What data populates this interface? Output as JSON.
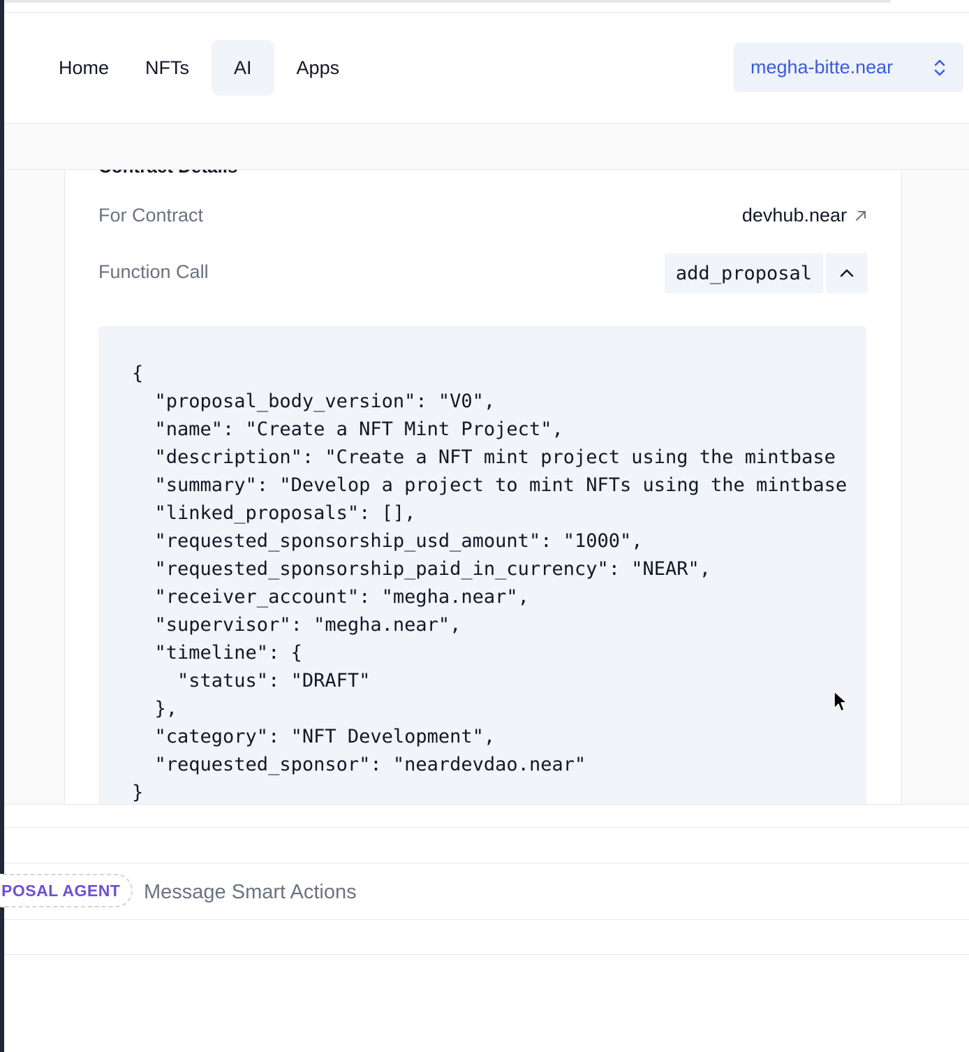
{
  "nav": {
    "items": [
      {
        "label": "Home"
      },
      {
        "label": "NFTs"
      },
      {
        "label": "AI"
      },
      {
        "label": "Apps"
      }
    ],
    "active": "AI"
  },
  "account": {
    "name": "megha-bitte.near",
    "icon": "chevron-up-down-icon"
  },
  "card": {
    "title": "Contract Details",
    "contract_label": "For Contract",
    "contract_value": "devhub.near",
    "function_label": "Function Call",
    "function_value": "add_proposal",
    "code": "{\n  \"proposal_body_version\": \"V0\",\n  \"name\": \"Create a NFT Mint Project\",\n  \"description\": \"Create a NFT mint project using the mintbase\n  \"summary\": \"Develop a project to mint NFTs using the mintbase\n  \"linked_proposals\": [],\n  \"requested_sponsorship_usd_amount\": \"1000\",\n  \"requested_sponsorship_paid_in_currency\": \"NEAR\",\n  \"receiver_account\": \"megha.near\",\n  \"supervisor\": \"megha.near\",\n  \"timeline\": {\n    \"status\": \"DRAFT\"\n  },\n  \"category\": \"NFT Development\",\n  \"requested_sponsor\": \"neardevdao.near\"\n}"
  },
  "input": {
    "agent_chip": "POSAL AGENT",
    "placeholder": "Message Smart Actions"
  },
  "colors": {
    "accent": "#3b5bdb",
    "agent": "#6d4fd8",
    "muted": "#6b7280"
  }
}
